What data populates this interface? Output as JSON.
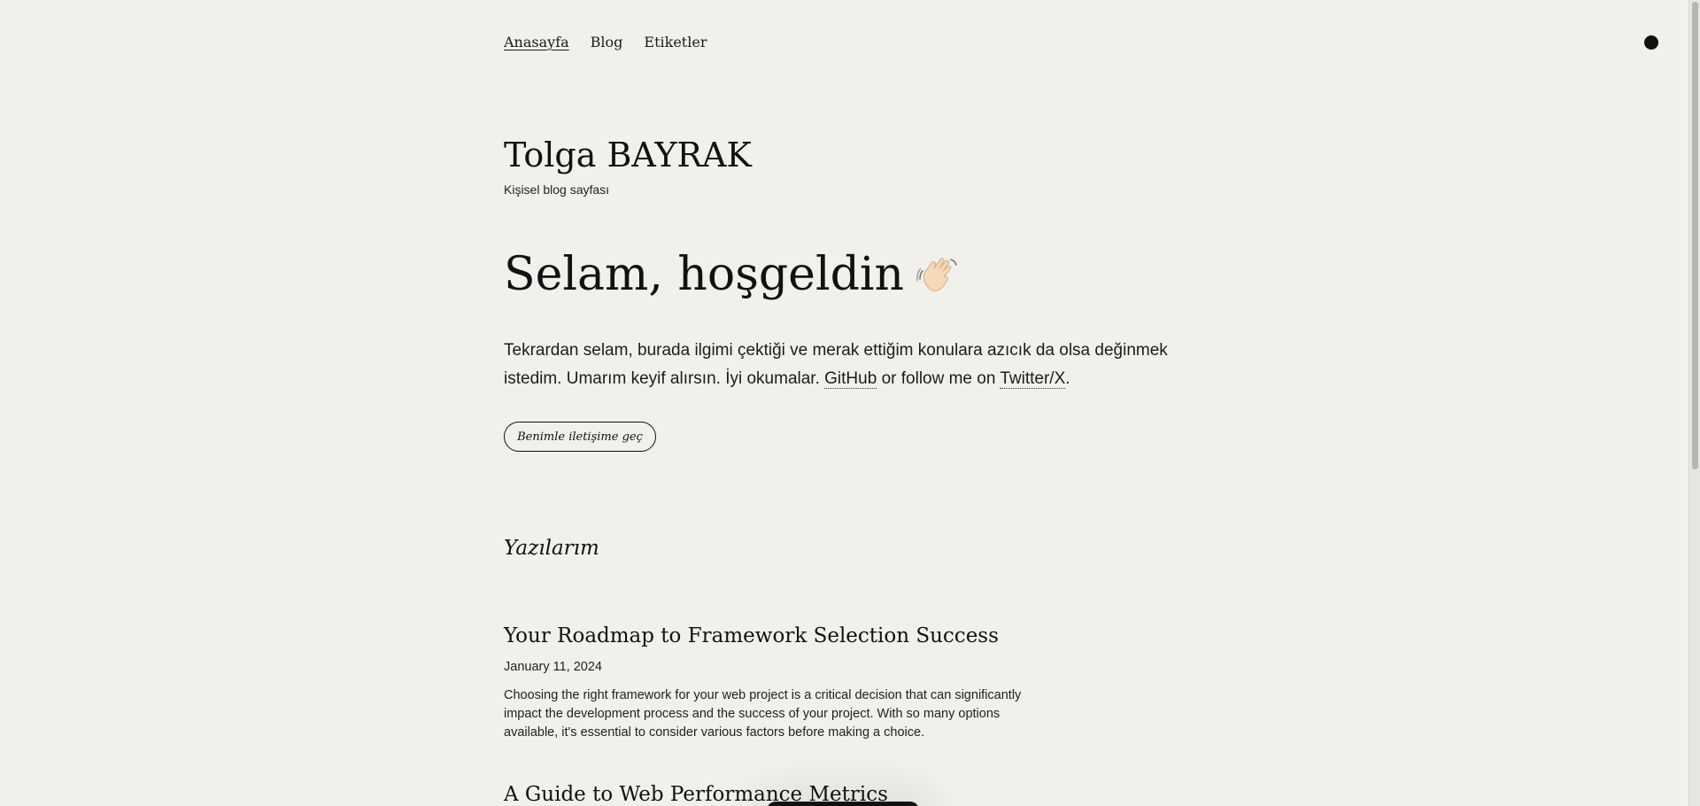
{
  "nav": {
    "items": [
      {
        "label": "Anasayfa",
        "active": true
      },
      {
        "label": "Blog",
        "active": false
      },
      {
        "label": "Etiketler",
        "active": false
      }
    ],
    "theme_toggle_icon": "dark-mode-dot-icon"
  },
  "header": {
    "title": "Tolga BAYRAK",
    "subtitle": "Kişisel blog sayfası"
  },
  "hero": {
    "title": "Selam, hoşgeldin",
    "title_icon": "waving-hand-icon",
    "intro_text": "Tekrardan selam, burada ilgimi çektiği ve merak ettiğim konulara azıcık da olsa değinmek istedim. Umarım keyif alırsın. İyi okumalar.",
    "github_label": "GitHub",
    "follow_text": "or follow me on",
    "twitter_label": "Twitter/X",
    "end_punct": ".",
    "contact_button": "Benimle iletişime geç"
  },
  "posts_section": {
    "title": "Yazılarım",
    "posts": [
      {
        "title": "Your Roadmap to Framework Selection Success",
        "date": "January 11, 2024",
        "excerpt": "Choosing the right framework for your web project is a critical decision that can significantly impact the development process and the success of your project. With so many options available, it's essential to consider various factors before making a choice."
      },
      {
        "title": "A Guide to Web Performance Metrics"
      }
    ]
  },
  "colors": {
    "background": "#f2f0ec",
    "text": "#111111"
  }
}
